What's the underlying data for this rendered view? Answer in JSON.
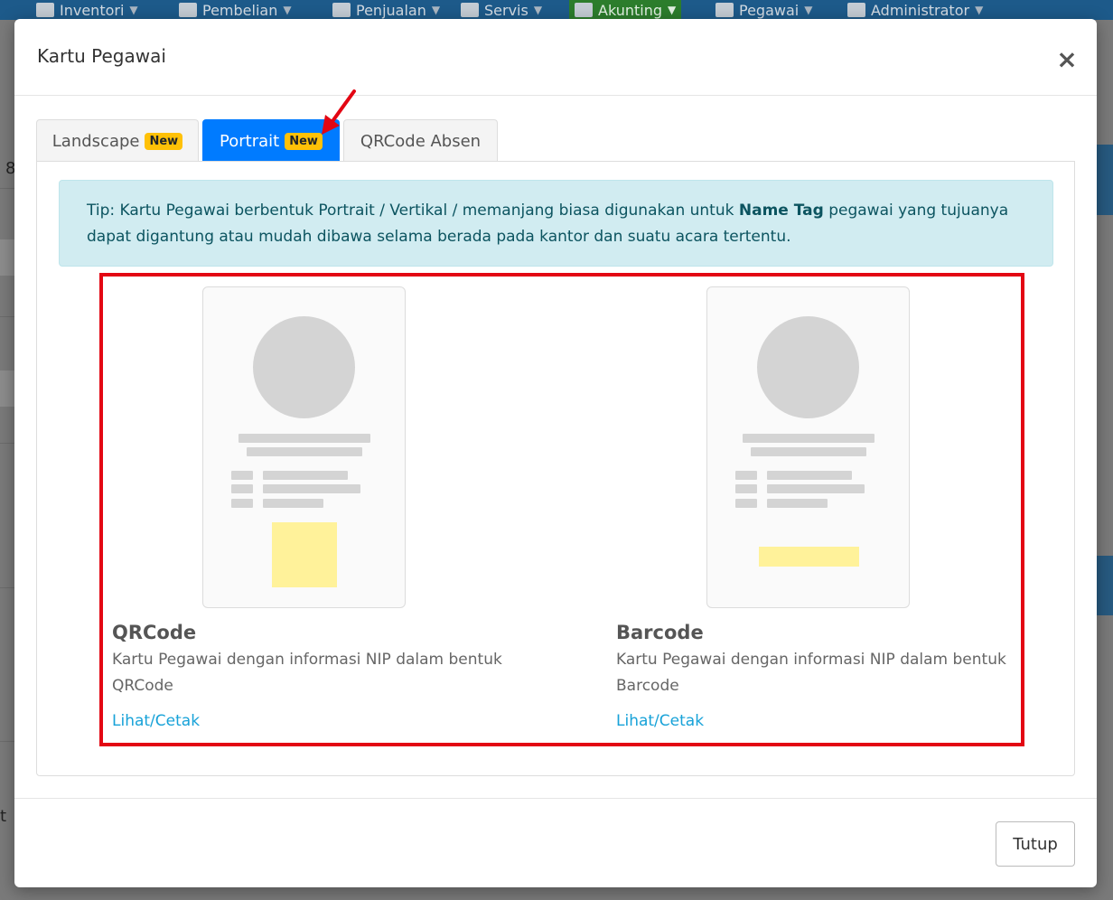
{
  "nav": {
    "items": [
      {
        "label": "Inventori",
        "icon": "box-icon"
      },
      {
        "label": "Pembelian",
        "icon": "cart-icon"
      },
      {
        "label": "Penjualan",
        "icon": "document-icon"
      },
      {
        "label": "Servis",
        "icon": "gears-icon"
      },
      {
        "label": "Akunting",
        "icon": "money-icon"
      },
      {
        "label": "Pegawai",
        "icon": "id-card-icon"
      },
      {
        "label": "Administrator",
        "icon": "gear-icon"
      }
    ],
    "active": "Akunting"
  },
  "background": {
    "left_digit": "8",
    "left_letter": "t"
  },
  "modal": {
    "title": "Kartu Pegawai",
    "close_icon": "×",
    "tabs": [
      {
        "label": "Landscape",
        "badge": "New"
      },
      {
        "label": "Portrait",
        "badge": "New"
      },
      {
        "label": "QRCode Absen",
        "badge": ""
      }
    ],
    "active_tab": "Portrait",
    "tip": {
      "before": "Tip: Kartu Pegawai berbentuk Portrait / Vertikal / memanjang biasa digunakan untuk ",
      "bold": "Name Tag",
      "after": " pegawai yang tujuanya dapat digantung atau mudah dibawa selama berada pada kantor dan suatu acara tertentu."
    },
    "options": [
      {
        "title": "QRCode",
        "description": "Kartu Pegawai dengan informasi NIP dalam bentuk QRCode",
        "link": "Lihat/Cetak"
      },
      {
        "title": "Barcode",
        "description": "Kartu Pegawai dengan informasi NIP dalam bentuk Barcode",
        "link": "Lihat/Cetak"
      }
    ],
    "footer": {
      "close_label": "Tutup"
    }
  },
  "colors": {
    "active_tab": "#007bff",
    "badge": "#ffc107",
    "tip_bg": "#d1ecf1",
    "tip_text": "#0c5460",
    "highlight": "#e30613",
    "link": "#17a2d8",
    "code_placeholder": "#fff29a",
    "nav_active": "#2c7d2c"
  }
}
